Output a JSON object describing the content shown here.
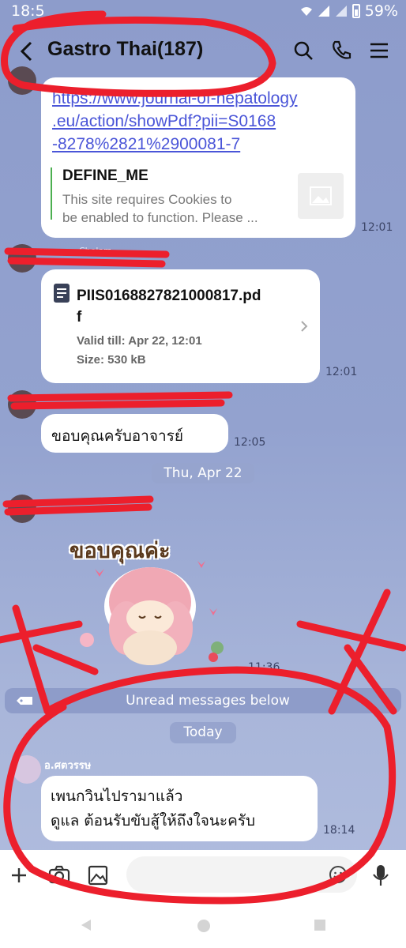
{
  "status": {
    "time": "18:5",
    "battery": "59%"
  },
  "header": {
    "title": "Gastro Thai(187)"
  },
  "messages": {
    "link_card": {
      "url": "https://www.journal-of-hepatology.eu/action/showPdf?pii=S0168-8278%2821%2900081-7",
      "url_lines": [
        "https://www.journal-of-hepatology",
        ".eu/action/showPdf?pii=S0168",
        "-8278%2821%2900081-7"
      ],
      "preview_title": "DEFINE_ME",
      "preview_desc_1": "This site requires Cookies to",
      "preview_desc_2": "be enabled to function. Please ...",
      "time": "12:01"
    },
    "file": {
      "sender_partial": "Cholarr",
      "name_line1": "PIIS0168827821000817.pd",
      "name_line2": "f",
      "valid": "Valid till: Apr 22, 12:01",
      "size": "Size: 530 kB",
      "time": "12:01"
    },
    "thanks": {
      "text": "ขอบคุณครับอาจารย์",
      "time": "12:05"
    },
    "date_sep_1": "Thu, Apr 22",
    "sticker": {
      "caption": "ขอบคุณค่ะ",
      "time": "11:36"
    },
    "unread": "Unread messages below",
    "date_sep_2": "Today",
    "last": {
      "sender": "อ.ศตวรรษ",
      "line1": "เพนกวินไปรามาแล้ว",
      "line2": "ดูแล ต้อนรับขับสู้ให้ถึงใจนะครับ",
      "time": "18:14"
    }
  },
  "colors": {
    "chat_bg": "#8d9ccb",
    "link": "#4a55d8",
    "scribble": "#ec1f2c"
  }
}
